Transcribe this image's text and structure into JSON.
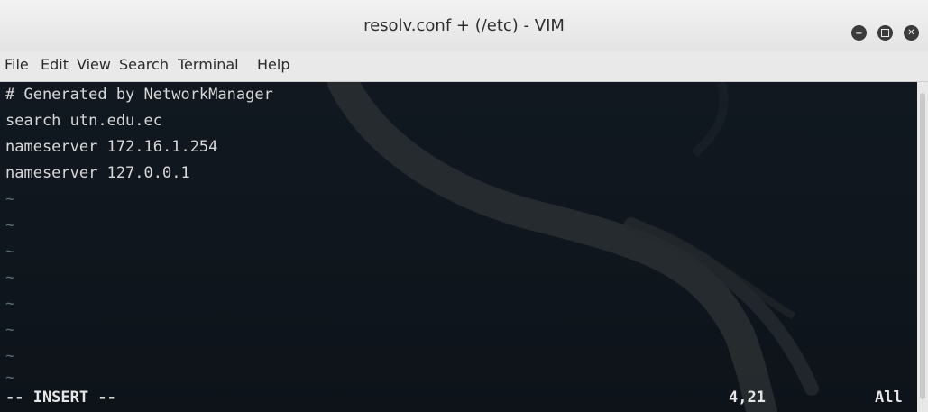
{
  "window": {
    "title": "resolv.conf + (/etc) - VIM",
    "buttons": [
      "minimize-icon",
      "maximize-icon",
      "close-icon"
    ]
  },
  "menu": {
    "items": [
      "File",
      "Edit",
      "View",
      "Search",
      "Terminal",
      "Help"
    ]
  },
  "editor": {
    "lines": [
      "# Generated by NetworkManager",
      "search utn.edu.ec",
      "nameserver 172.16.1.254",
      "nameserver 127.0.0.1"
    ],
    "tilde": "~",
    "mode": "-- INSERT --",
    "cursor_position": "4,21",
    "scroll_position": "All"
  },
  "colors": {
    "terminal_bg": "#111820",
    "text": "#d8d8d8",
    "titlebar": "#ebebeb"
  }
}
